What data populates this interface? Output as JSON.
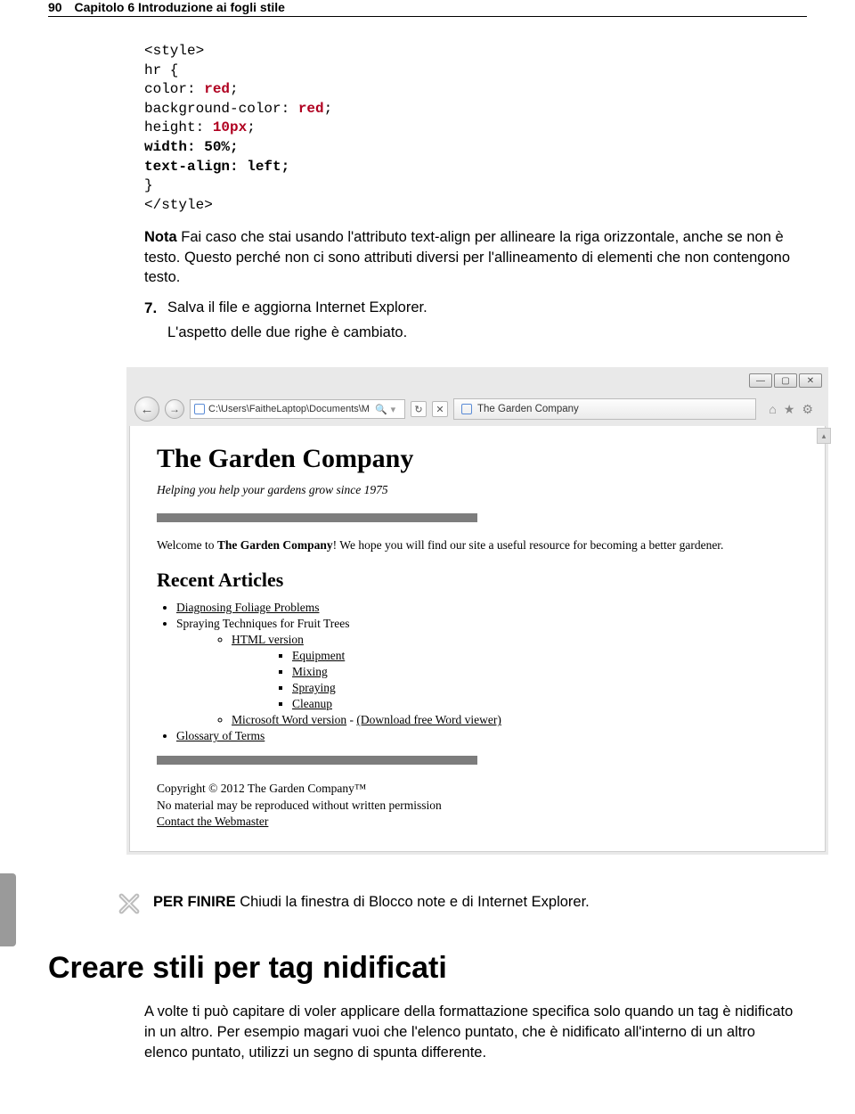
{
  "header": {
    "page_number": "90",
    "chapter": "Capitolo 6 Introduzione ai fogli stile"
  },
  "code": {
    "l1": "<style>",
    "l2": "hr {",
    "l3a": "color: ",
    "l3b": "red",
    "l3c": ";",
    "l4a": "background-color: ",
    "l4b": "red",
    "l4c": ";",
    "l5a": "height: ",
    "l5b": "10px",
    "l5c": ";",
    "l6a": "width: 50%;",
    "l6b": "text-align: left;",
    "l7": "}",
    "l8": "</style>"
  },
  "nota": {
    "lead": "Nota",
    "text": " Fai caso che stai usando l'attributo text-align per allineare la riga orizzontale, anche se non è testo. Questo perché non ci sono attributi diversi per l'allineamento di elementi che non contengono testo."
  },
  "step": {
    "num": "7.",
    "text": "Salva il file e aggiorna Internet Explorer."
  },
  "step_result": "L'aspetto delle due righe è cambiato.",
  "browser": {
    "address": "C:\\Users\\FaitheLaptop\\Documents\\M",
    "tab_title": "The Garden Company",
    "page": {
      "title": "The Garden Company",
      "tagline": "Helping you help your gardens grow since 1975",
      "welcome_pre": "Welcome to ",
      "welcome_b": "The Garden Company",
      "welcome_post": "! We hope you will find our site a useful resource for becoming a better gardener.",
      "recent": "Recent Articles",
      "items": {
        "a": "Diagnosing Foliage Problems",
        "b": "Spraying Techniques for Fruit Trees",
        "b1": "HTML version",
        "b1a": "Equipment",
        "b1b": "Mixing",
        "b1c": "Spraying",
        "b1d": "Cleanup",
        "b2a": "Microsoft Word version",
        "b2sep": " - ",
        "b2b": "(Download free Word viewer)",
        "c": "Glossary of Terms"
      },
      "footer1": "Copyright © 2012 The Garden Company™",
      "footer2": "No material may be reproduced without written permission",
      "footer3": "Contact the Webmaster"
    }
  },
  "perfinire": {
    "lead": "PER FINIRE",
    "text": " Chiudi la finestra di Blocco note e di Internet Explorer."
  },
  "h2": "Creare stili per tag nidificati",
  "section": "A volte ti può capitare di voler applicare della formattazione specifica solo quando un tag è nidificato in un altro. Per esempio magari vuoi che l'elenco puntato, che è nidificato all'interno di un altro elenco puntato, utilizzi un segno di spunta differente."
}
